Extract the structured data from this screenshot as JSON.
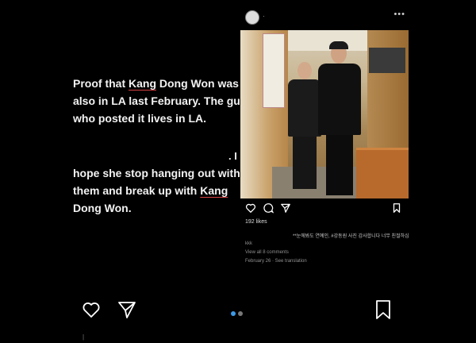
{
  "caption": {
    "block1_a": "Proof that ",
    "block1_name": "Kang",
    "block1_b": " Dong Won was also in LA last February. The guy who posted it lives in LA.",
    "mark": ". I",
    "block2_a": "hope she stop hanging out with them and break up with ",
    "block2_name": "Kang",
    "block2_b": " Dong Won."
  },
  "post": {
    "username": "·",
    "more": "•••",
    "likes": "192 likes",
    "caption_korean": "**눈에봐도 연예인, #강동원 사진 감사합니다 너무 친절하심",
    "meta_1": "kkk",
    "meta_2": "View all 8 comments",
    "meta_3": "February 26 · See translation"
  },
  "bottom_tick": "|",
  "colors": {
    "accent": "#3d9ae8",
    "background": "#000000",
    "underline": "#d64040"
  }
}
